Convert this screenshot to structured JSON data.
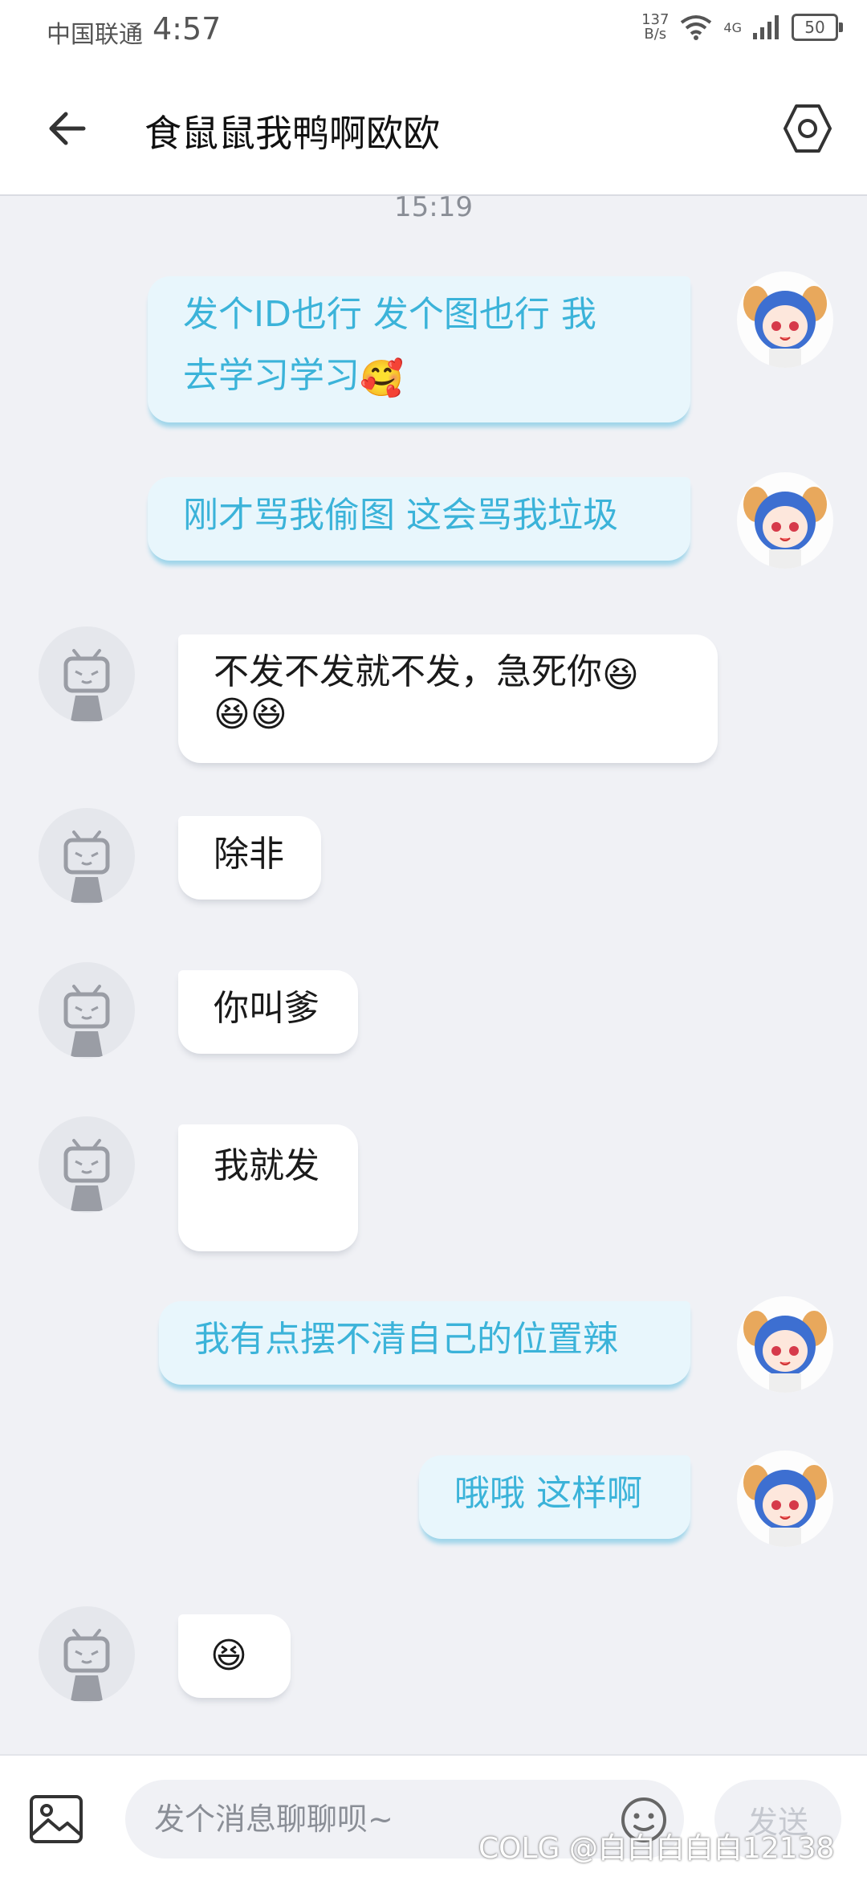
{
  "status_bar": {
    "carrier": "中国联通",
    "time": "4:57",
    "net_speed_value": "137",
    "net_speed_unit": "B/s",
    "network_type": "4G",
    "battery": "50"
  },
  "header": {
    "title": "食鼠鼠我鸭啊欧欧"
  },
  "timestamp": "15:19",
  "messages": [
    {
      "side": "me",
      "line1": "发个ID也行 发个图也行 我",
      "line2": "去学习学习",
      "emoji": "🥰"
    },
    {
      "side": "me",
      "text": "刚才骂我偷图 这会骂我垃圾"
    },
    {
      "side": "other",
      "line1": "不发不发就不发，急死你",
      "emoji1": "😆",
      "emoji2": "😆😆"
    },
    {
      "side": "other",
      "text": "除非"
    },
    {
      "side": "other",
      "text": "你叫爹"
    },
    {
      "side": "other",
      "text": "我就发"
    },
    {
      "side": "me",
      "text": "我有点摆不清自己的位置辣"
    },
    {
      "side": "me",
      "text": "哦哦 这样啊"
    },
    {
      "side": "other",
      "emoji": "😆"
    }
  ],
  "input_bar": {
    "placeholder": "发个消息聊聊呗~",
    "send_label": "发送"
  },
  "watermark": "COLG @白白白白白12138",
  "colors": {
    "me_bubble_bg": "#e8f6fc",
    "me_bubble_text": "#3bb3d9",
    "other_bubble_bg": "#ffffff",
    "page_bg": "#f0f1f5"
  }
}
